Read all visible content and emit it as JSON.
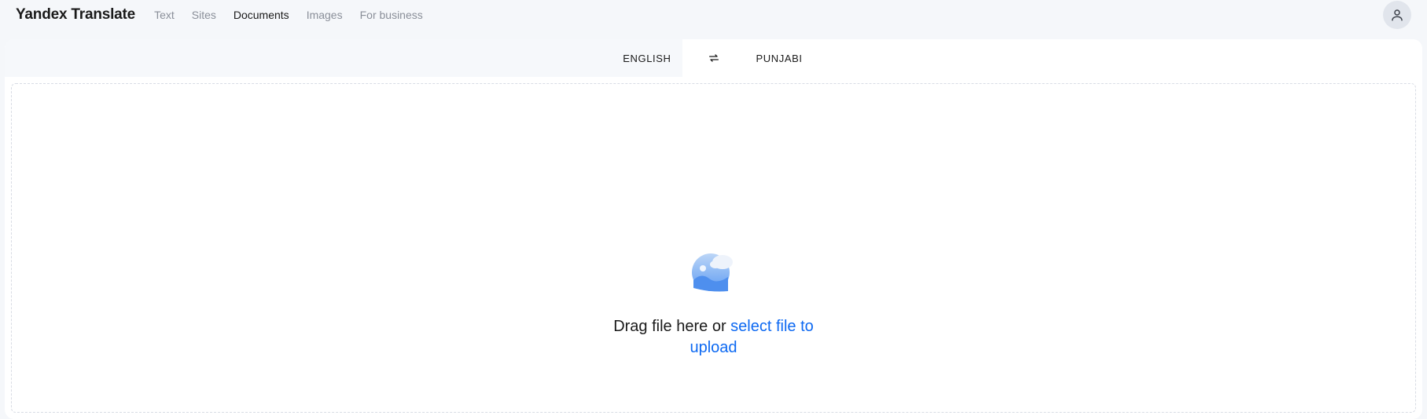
{
  "header": {
    "logo": "Yandex Translate",
    "nav": {
      "text": "Text",
      "sites": "Sites",
      "documents": "Documents",
      "images": "Images",
      "for_business": "For business"
    }
  },
  "languages": {
    "source": "ENGLISH",
    "target": "PUNJABI"
  },
  "dropzone": {
    "prefix": "Drag file here or ",
    "link": "select file to upload"
  }
}
